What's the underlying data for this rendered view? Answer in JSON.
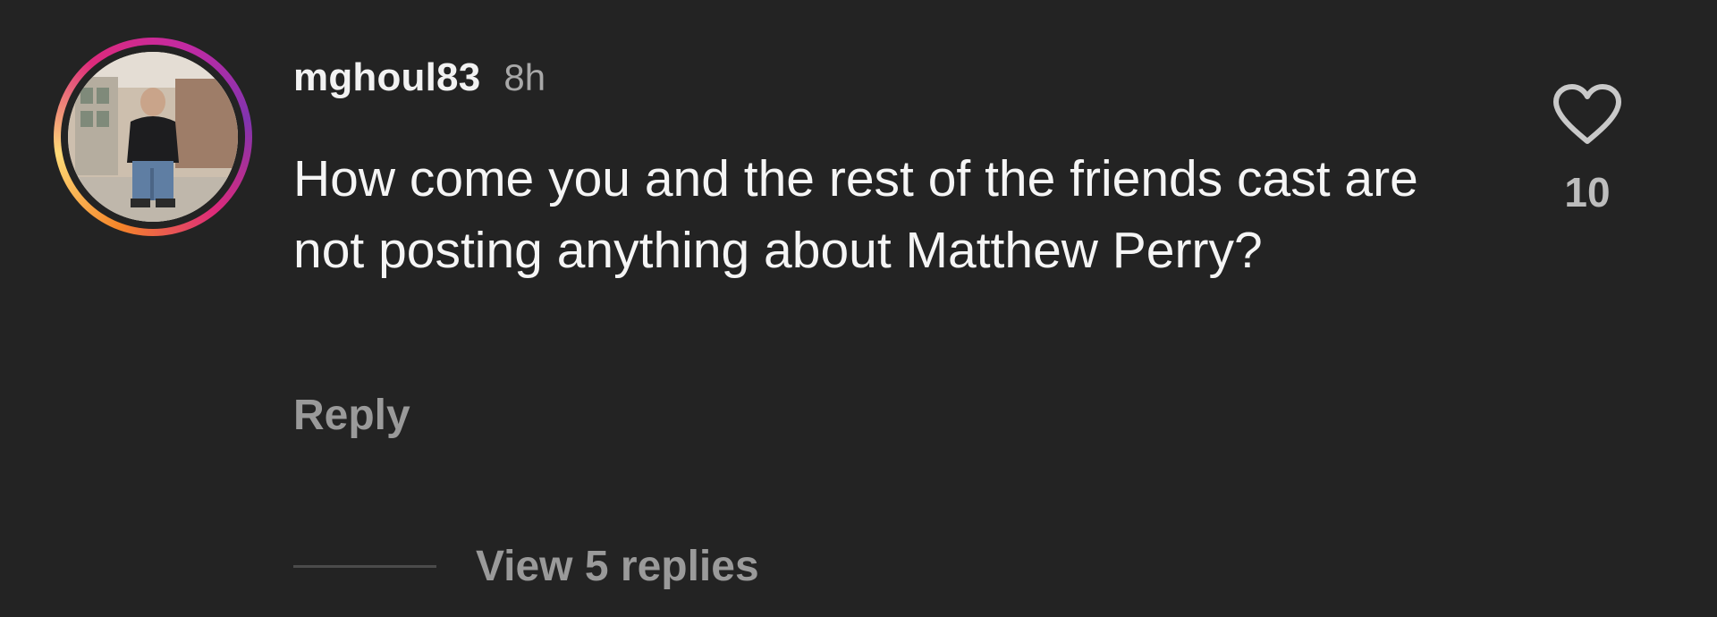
{
  "comment": {
    "username": "mghoul83",
    "timestamp": "8h",
    "text": "How come you and the rest of the friends cast are not posting anything about Matthew Perry?",
    "reply_label": "Reply",
    "like_count": "10",
    "view_replies_label": "View 5 replies",
    "avatar_icon": "user-avatar-photo",
    "like_icon": "heart-outline-icon"
  },
  "colors": {
    "background": "#232323",
    "primary_text": "#f5f5f5",
    "secondary_text": "#9a9a9a",
    "story_ring": [
      "#f58529",
      "#feda77",
      "#dd2a7b",
      "#c32aa3",
      "#8134af"
    ]
  }
}
